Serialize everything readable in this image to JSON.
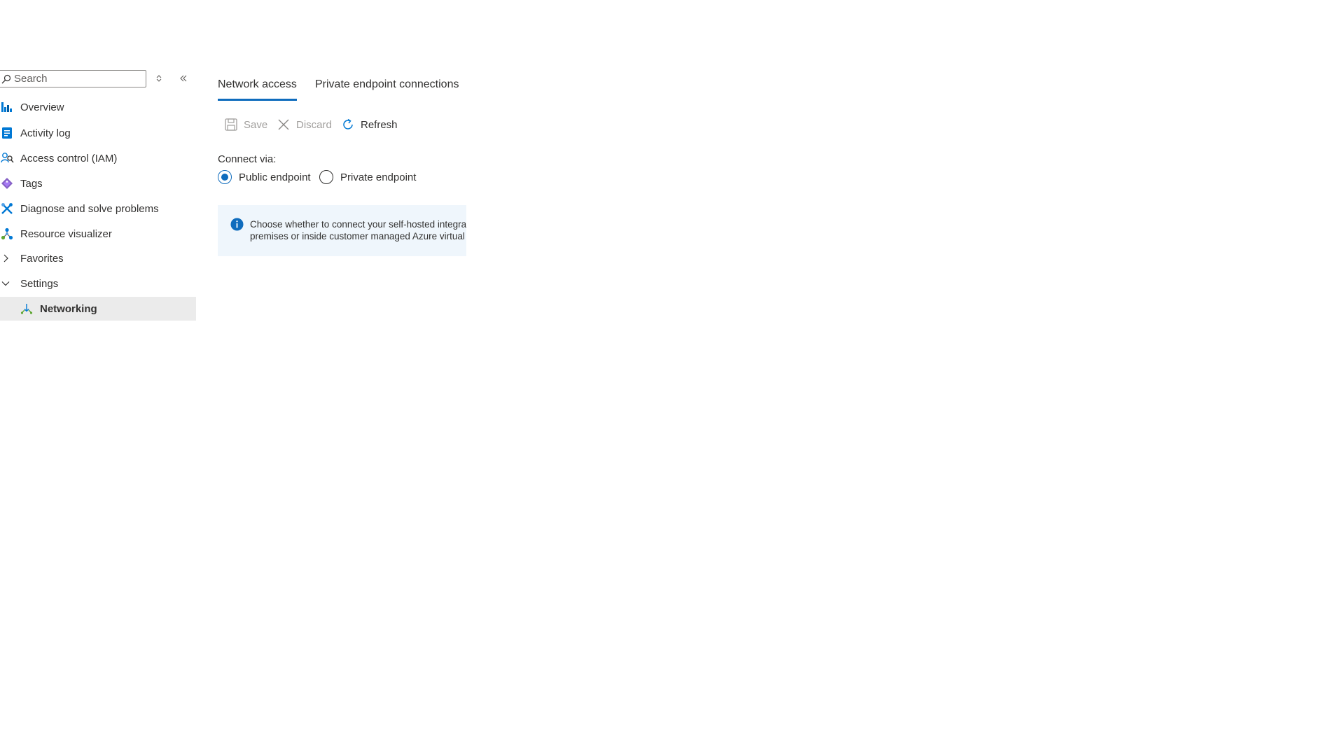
{
  "sidebar": {
    "search": {
      "placeholder": "Search",
      "value": ""
    },
    "items": [
      {
        "label": "Overview",
        "icon": "overview-icon"
      },
      {
        "label": "Activity log",
        "icon": "activity-log-icon"
      },
      {
        "label": "Access control (IAM)",
        "icon": "people-icon"
      },
      {
        "label": "Tags",
        "icon": "tag-icon"
      },
      {
        "label": "Diagnose and solve problems",
        "icon": "wrench-icon"
      },
      {
        "label": "Resource visualizer",
        "icon": "hierarchy-icon"
      },
      {
        "label": "Favorites",
        "icon": "chevron-right-icon"
      },
      {
        "label": "Settings",
        "icon": "chevron-down-icon"
      },
      {
        "label": "Networking",
        "icon": "networking-icon",
        "selected": true
      }
    ]
  },
  "main": {
    "tabs": [
      {
        "label": "Network access",
        "active": true
      },
      {
        "label": "Private endpoint connections",
        "active": false
      }
    ],
    "commands": {
      "save": "Save",
      "discard": "Discard",
      "refresh": "Refresh"
    },
    "connect_via": {
      "label": "Connect via:",
      "options": [
        {
          "label": "Public endpoint",
          "checked": true
        },
        {
          "label": "Private endpoint",
          "checked": false
        }
      ]
    },
    "info": {
      "line1": "Choose whether to connect your self-hosted integration runtime",
      "line2": "premises or inside customer managed Azure virtual network"
    }
  },
  "colors": {
    "accent": "#0f6cbd",
    "selected_bg": "#ebebeb",
    "info_bg": "#eff6fc",
    "disabled_text": "#a19f9d"
  }
}
